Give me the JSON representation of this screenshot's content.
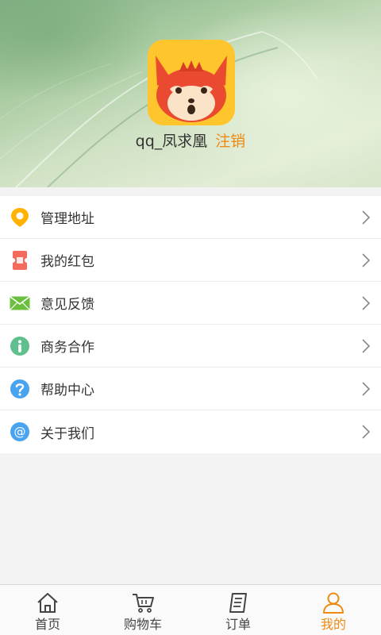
{
  "profile": {
    "username": "qq_凤求凰",
    "logout_label": "注销",
    "avatar_icon": "fox-avatar-icon"
  },
  "menu": {
    "items": [
      {
        "label": "管理地址",
        "icon": "location-pin-icon",
        "color": "#ffb300"
      },
      {
        "label": "我的红包",
        "icon": "red-envelope-icon",
        "color": "#f26b5b"
      },
      {
        "label": "意见反馈",
        "icon": "mail-icon",
        "color": "#6cbf3e"
      },
      {
        "label": "商务合作",
        "icon": "info-icon",
        "color": "#5fc08e"
      },
      {
        "label": "帮助中心",
        "icon": "help-icon",
        "color": "#4aa3f0"
      },
      {
        "label": "关于我们",
        "icon": "at-icon",
        "color": "#4aa3f0"
      }
    ]
  },
  "tabbar": {
    "tabs": [
      {
        "label": "首页",
        "icon": "home-icon",
        "active": false
      },
      {
        "label": "购物车",
        "icon": "cart-icon",
        "active": false
      },
      {
        "label": "订单",
        "icon": "order-icon",
        "active": false
      },
      {
        "label": "我的",
        "icon": "user-icon",
        "active": true
      }
    ]
  },
  "colors": {
    "accent": "#ee8a12",
    "background": "#f3f3f3"
  }
}
